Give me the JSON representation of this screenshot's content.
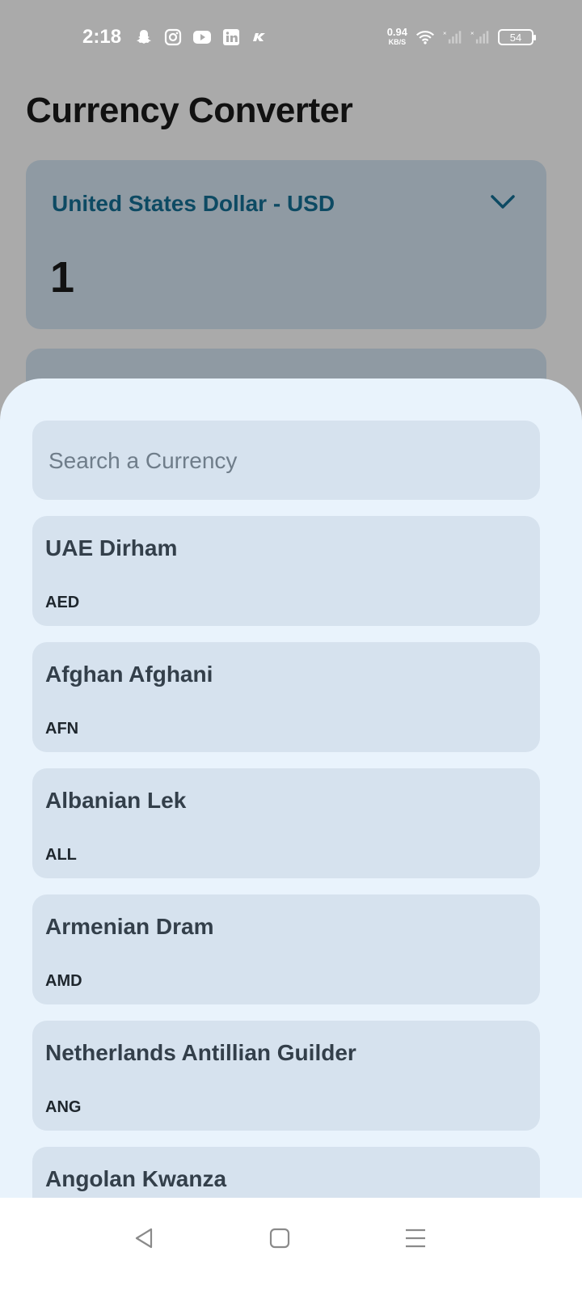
{
  "status_bar": {
    "time": "2:18",
    "net_speed_value": "0.94",
    "net_speed_unit": "KB/S",
    "battery": "54",
    "icons_left": [
      "snapchat-icon",
      "instagram-icon",
      "youtube-icon",
      "linkedin-icon",
      "k-app-icon"
    ],
    "icons_right": [
      "wifi-icon",
      "signal-icon-1",
      "signal-icon-2"
    ]
  },
  "header": {
    "title": "Currency Converter"
  },
  "from_card": {
    "currency": "United States Dollar - USD",
    "amount": "1"
  },
  "sheet": {
    "search_placeholder": "Search a Currency",
    "items": [
      {
        "name": "UAE Dirham",
        "code": "AED"
      },
      {
        "name": "Afghan Afghani",
        "code": "AFN"
      },
      {
        "name": "Albanian Lek",
        "code": "ALL"
      },
      {
        "name": "Armenian Dram",
        "code": "AMD"
      },
      {
        "name": "Netherlands Antillian Guilder",
        "code": "ANG"
      },
      {
        "name": "Angolan Kwanza",
        "code": ""
      }
    ]
  },
  "colors": {
    "accent": "#0d4a63",
    "sheet_background": "#e9f3fc",
    "card_background": "#d6e2ee",
    "overlay_card": "#8f9aa3"
  }
}
